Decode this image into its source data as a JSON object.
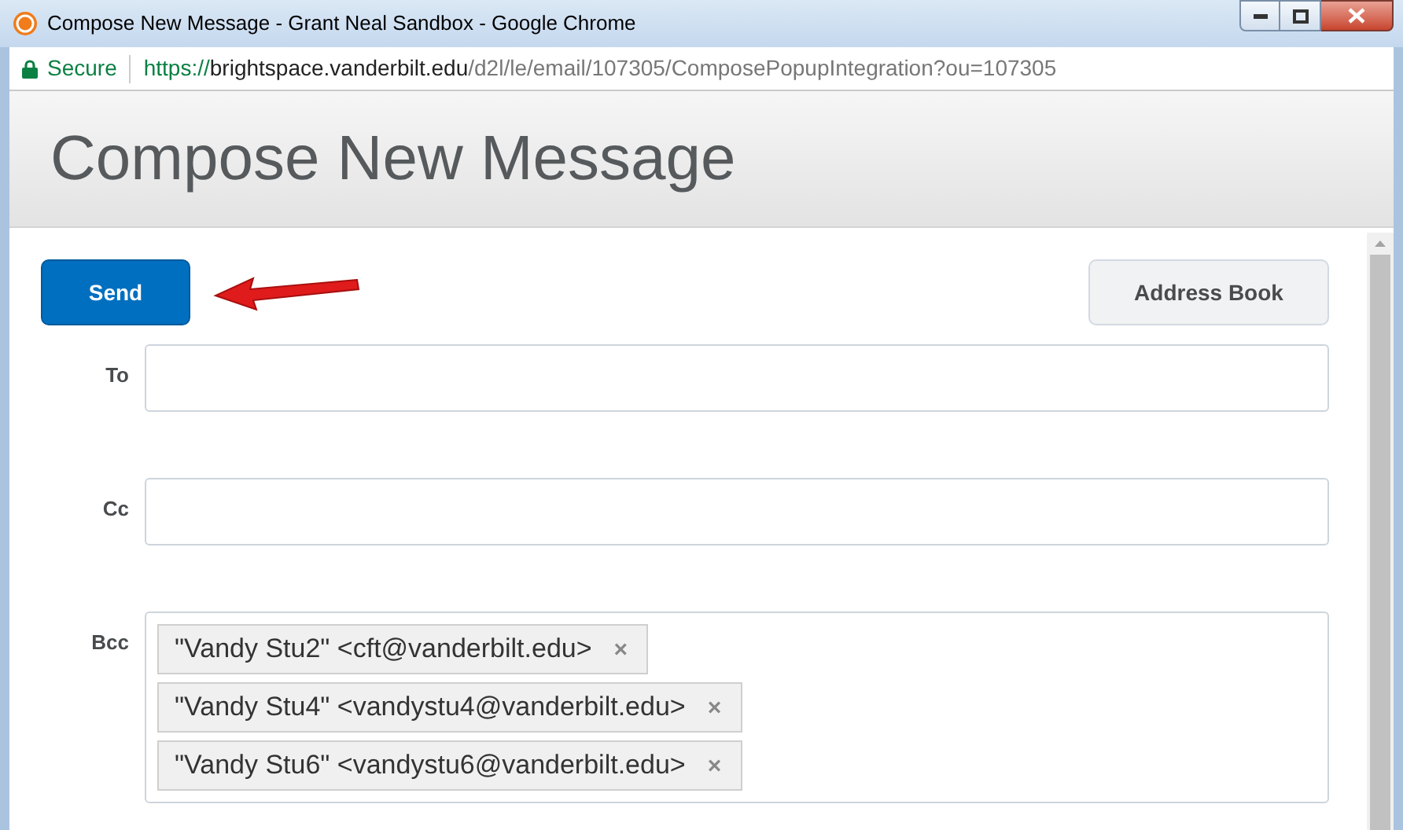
{
  "window": {
    "title": "Compose New Message - Grant Neal Sandbox - Google Chrome"
  },
  "address_bar": {
    "secure_label": "Secure",
    "url": {
      "scheme": "https://",
      "host": "brightspace.vanderbilt.edu",
      "path": "/d2l/le/email/107305/ComposePopupIntegration?ou=107305"
    }
  },
  "page": {
    "heading": "Compose New Message"
  },
  "toolbar": {
    "send": "Send",
    "address_book": "Address Book"
  },
  "fields": [
    {
      "label": "To"
    },
    {
      "label": "Cc"
    },
    {
      "label": "Bcc",
      "recipients": [
        {
          "text": "\"Vandy Stu2\" <cft@vanderbilt.edu>",
          "remove": "×"
        },
        {
          "text": "\"Vandy Stu4\" <vandystu4@vanderbilt.edu>",
          "remove": "×"
        },
        {
          "text": "\"Vandy Stu6\" <vandystu6@vanderbilt.edu>",
          "remove": "×"
        }
      ]
    }
  ]
}
